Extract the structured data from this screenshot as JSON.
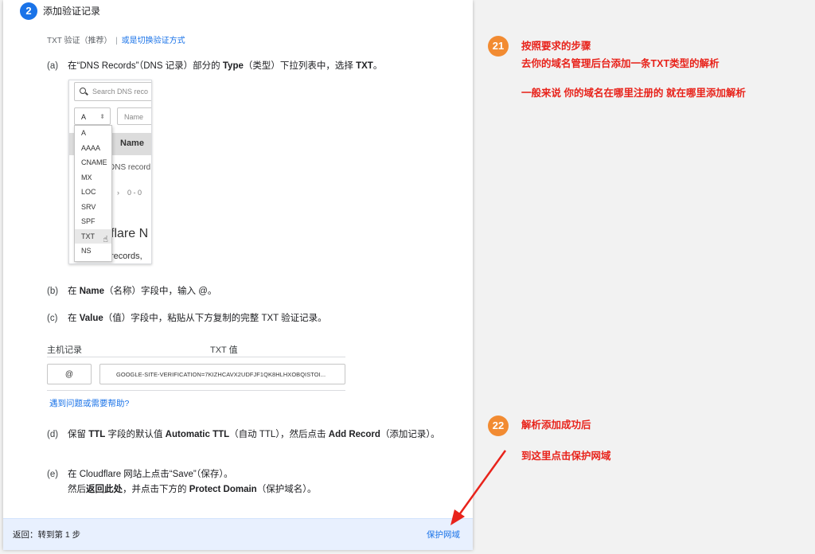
{
  "step": {
    "number": "2",
    "title": "添加验证记录"
  },
  "method": {
    "current": "TXT 验证（推荐）",
    "separator": "|",
    "switch_link": "或是切换验证方式"
  },
  "steps": {
    "a": {
      "label": "(a)",
      "pre": "在“DNS Records”（DNS 记录）部分的 ",
      "bold1": "Type",
      "mid": "（类型）下拉列表中，选择 ",
      "bold2": "TXT",
      "post": "。"
    },
    "b": {
      "label": "(b)",
      "pre": "在 ",
      "bold1": "Name",
      "post": "（名称）字段中，输入 @。"
    },
    "c": {
      "label": "(c)",
      "pre": "在 ",
      "bold1": "Value",
      "post": "（值）字段中，粘贴从下方复制的完整 TXT 验证记录。"
    },
    "d": {
      "label": "(d)",
      "pre": "保留 ",
      "bold1": "TTL",
      "mid": " 字段的默认值 ",
      "bold2": "Automatic TTL",
      "mid2": "（自动 TTL），然后点击 ",
      "bold3": "Add Record",
      "post": "（添加记录）。"
    },
    "e": {
      "label": "(e)",
      "line1": "在 Cloudflare 网站上点击“Save”（保存）。",
      "pre2": "然后",
      "bold1": "返回此处",
      "mid2": "，并点击下方的 ",
      "bold2": "Protect Domain",
      "post2": "（保护域名）。"
    }
  },
  "dns_screenshot": {
    "search_placeholder": "Search DNS reco",
    "type_value": "A",
    "name_placeholder": "Name",
    "column_name": "Name",
    "row_fragment": "DNS record",
    "pagination": "0 - 0",
    "big_text": "flare N",
    "small_text": "records,",
    "type_options": [
      "A",
      "AAAA",
      "CNAME",
      "MX",
      "LOC",
      "SRV",
      "SPF",
      "TXT",
      "NS"
    ],
    "highlighted_option": "TXT"
  },
  "record_table": {
    "host_header": "主机记录",
    "txt_header": "TXT 值",
    "host_value": "@",
    "txt_value": "GOOGLE-SITE-VERIFICATION=7KIZHCAVX2UDFJF1QK8HLHXOBQISTOI..."
  },
  "help_link": "遇到问题或需要帮助?",
  "footer": {
    "back": "返回：转到第 1 步",
    "protect": "保护网域"
  },
  "annotations": [
    {
      "number": "21",
      "lines": [
        "按照要求的步骤",
        "去你的域名管理后台添加一条TXT类型的解析",
        "",
        "一般来说 你的域名在哪里注册的 就在哪里添加解析"
      ]
    },
    {
      "number": "22",
      "lines": [
        "解析添加成功后",
        "",
        "到这里点击保护网域"
      ]
    }
  ],
  "colors": {
    "accent": "#1a73e8",
    "annotation_red": "#e8231b",
    "annotation_circle": "#f28b32",
    "footer_bg": "#e8f0fe"
  }
}
